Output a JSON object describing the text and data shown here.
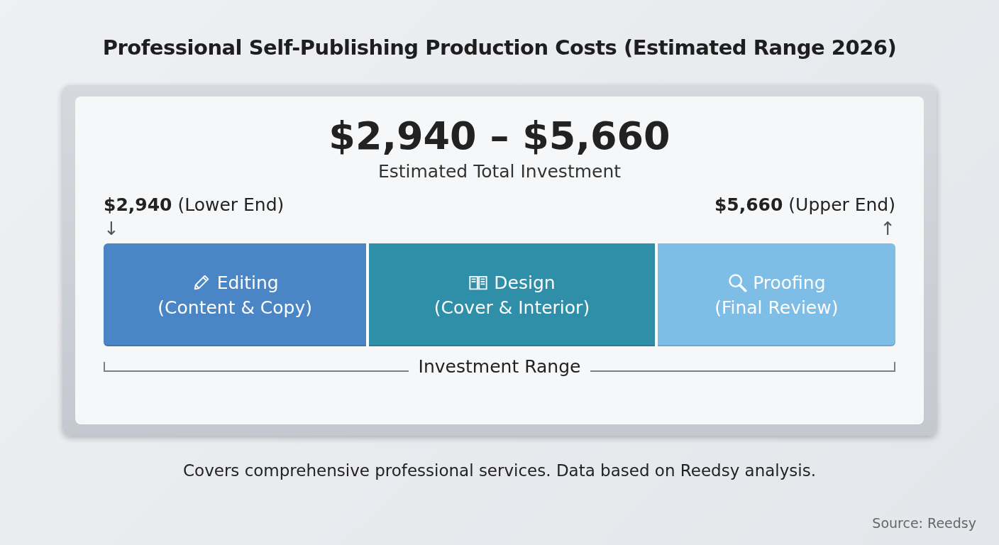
{
  "title": "Professional Self-Publishing Production Costs (Estimated Range 2026)",
  "total": {
    "amount": "$2,940 – $5,660",
    "caption": "Estimated Total Investment"
  },
  "lower": {
    "amount": "$2,940",
    "label": "(Lower End)",
    "arrow": "↓"
  },
  "upper": {
    "amount": "$5,660",
    "label": "(Upper End)",
    "arrow": "↑"
  },
  "segments": [
    {
      "name": "Editing",
      "detail": "(Content & Copy)",
      "color": "#4a86c5"
    },
    {
      "name": "Design",
      "detail": "(Cover & Interior)",
      "color": "#2f8ea8"
    },
    {
      "name": "Proofing",
      "detail": "(Final Review)",
      "color": "#7dbde6"
    }
  ],
  "range_label": "Investment Range",
  "note": "Covers comprehensive professional services. Data based on Reedsy analysis.",
  "source": "Source: Reedsy"
}
